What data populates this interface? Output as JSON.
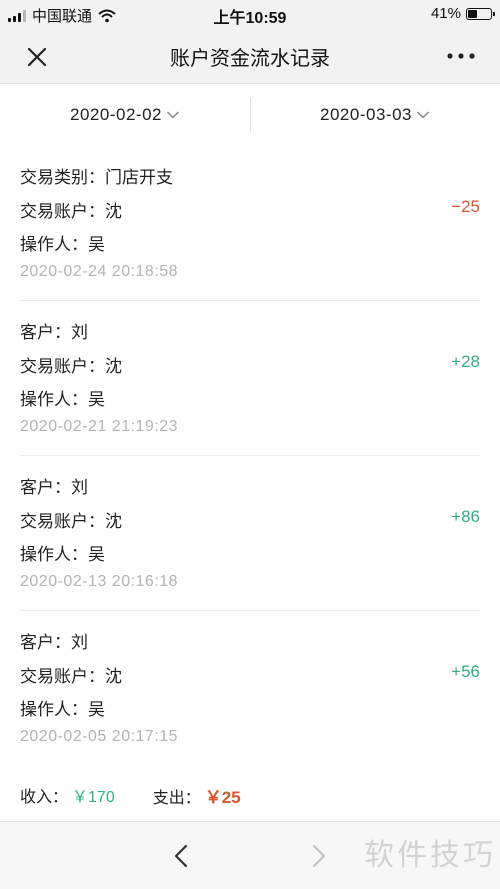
{
  "status_bar": {
    "carrier": "中国联通",
    "time": "上午10:59",
    "battery": "41%",
    "battery_level": 0.41,
    "wifi_icon": "wifi-icon",
    "signal_icon": "signal-icon"
  },
  "nav": {
    "title": "账户资金流水记录",
    "close_icon": "close-icon",
    "more_icon": "more-icon"
  },
  "filter": {
    "start_date": "2020-02-02",
    "end_date": "2020-03-03"
  },
  "records": [
    {
      "line1": "交易类别：门店开支",
      "line2": "交易账户：沈",
      "line3": "操作人：吴",
      "timestamp": "2020-02-24 20:18:58",
      "amount": "−25",
      "direction": "out"
    },
    {
      "line1": "客户：刘",
      "line2": "交易账户：沈",
      "line3": "操作人：吴",
      "timestamp": "2020-02-21 21:19:23",
      "amount": "+28",
      "direction": "in"
    },
    {
      "line1": "客户：刘",
      "line2": "交易账户：沈",
      "line3": "操作人：吴",
      "timestamp": "2020-02-13 20:16:18",
      "amount": "+86",
      "direction": "in"
    },
    {
      "line1": "客户：刘",
      "line2": "交易账户：沈",
      "line3": "操作人：吴",
      "timestamp": "2020-02-05 20:17:15",
      "amount": "+56",
      "direction": "in"
    }
  ],
  "summary": {
    "income_label": "收入：",
    "income_value": "￥170",
    "expense_label": "支出：",
    "expense_value": "￥25"
  },
  "toolbar": {
    "back_icon": "chevron-left-icon",
    "forward_icon": "chevron-right-icon"
  },
  "watermark": "软件技巧",
  "colors": {
    "positive": "#2fb07f",
    "negative": "#d4572a",
    "muted": "#b4b4b4"
  }
}
